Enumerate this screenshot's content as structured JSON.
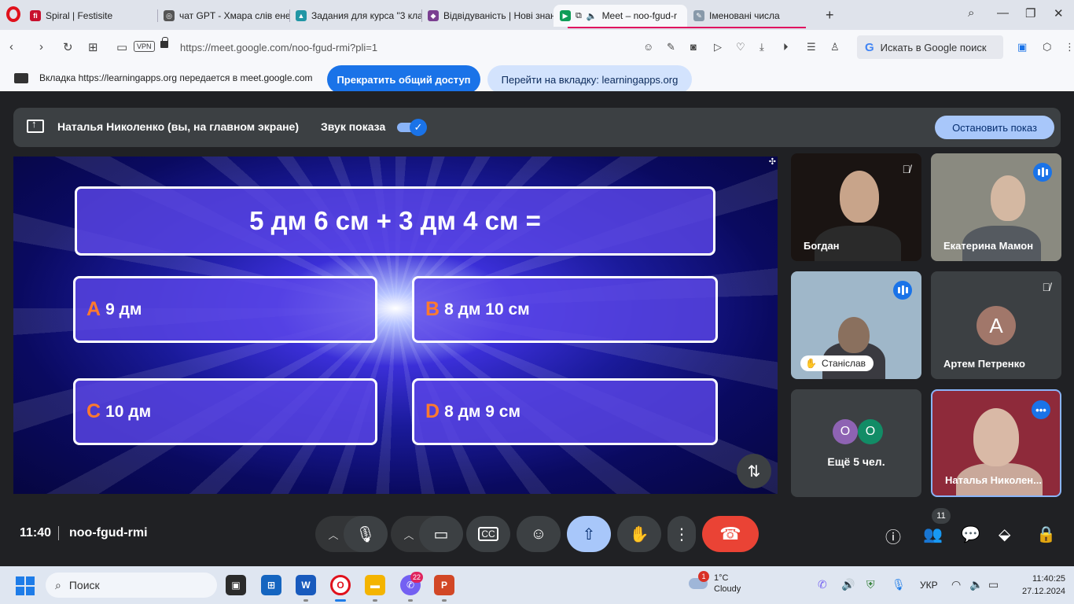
{
  "browser": {
    "tabs": [
      {
        "title": "Spiral | Festisite",
        "fav": "fi",
        "color": "#c8102e"
      },
      {
        "title": "чат GPT - Хмара слів ене",
        "fav": "◎",
        "color": "#555555"
      },
      {
        "title": "Задания для курса \"3 кла",
        "fav": "▲",
        "color": "#2196a5"
      },
      {
        "title": "Відвідуваність | Нові знан",
        "fav": "◆",
        "color": "#7b3f91"
      },
      {
        "title": "Meet – noo-fgud-r",
        "fav": "▶",
        "color": "#0f9d58"
      },
      {
        "title": "Іменовані числа",
        "fav": "✎",
        "color": "#8899aa"
      }
    ],
    "url": "https://meet.google.com/noo-fgud-rmi?pli=1",
    "vpn_label": "VPN",
    "search_placeholder": "Искать в Google поиск"
  },
  "share_banner": {
    "message": "Вкладка https://learningapps.org передается в meet.google.com",
    "stop_button": "Прекратить общий доступ",
    "goto_button": "Перейти на вкладку: learningapps.org"
  },
  "presenting": {
    "name": "Наталья Николенко (вы, на главном экране)",
    "sound_label": "Звук показа",
    "stop_button": "Остановить показ"
  },
  "quiz": {
    "question": "5 дм 6 см + 3 дм 4 см =",
    "answers": [
      {
        "letter": "A",
        "text": "9 дм"
      },
      {
        "letter": "B",
        "text": "8 дм 10 см"
      },
      {
        "letter": "C",
        "text": "10 дм"
      },
      {
        "letter": "D",
        "text": "8 дм 9 см"
      }
    ]
  },
  "participants": {
    "p1": "Богдан",
    "p2": "Екатерина Мамон",
    "p3": "Станіслав",
    "p4": "Артем Петренко",
    "p4_initial": "А",
    "more_initials": [
      "О",
      "О"
    ],
    "more_label": "Ещё 5 чел.",
    "self": "Наталья Николен..."
  },
  "controls": {
    "time": "11:40",
    "meeting_code": "noo-fgud-rmi",
    "people_count": "11"
  },
  "taskbar": {
    "search": "Поиск",
    "viber_badge": "22",
    "weather_badge": "1",
    "temp": "1°C",
    "weather": "Cloudy",
    "lang": "УКР",
    "time": "11:40:25",
    "date": "27.12.2024"
  }
}
